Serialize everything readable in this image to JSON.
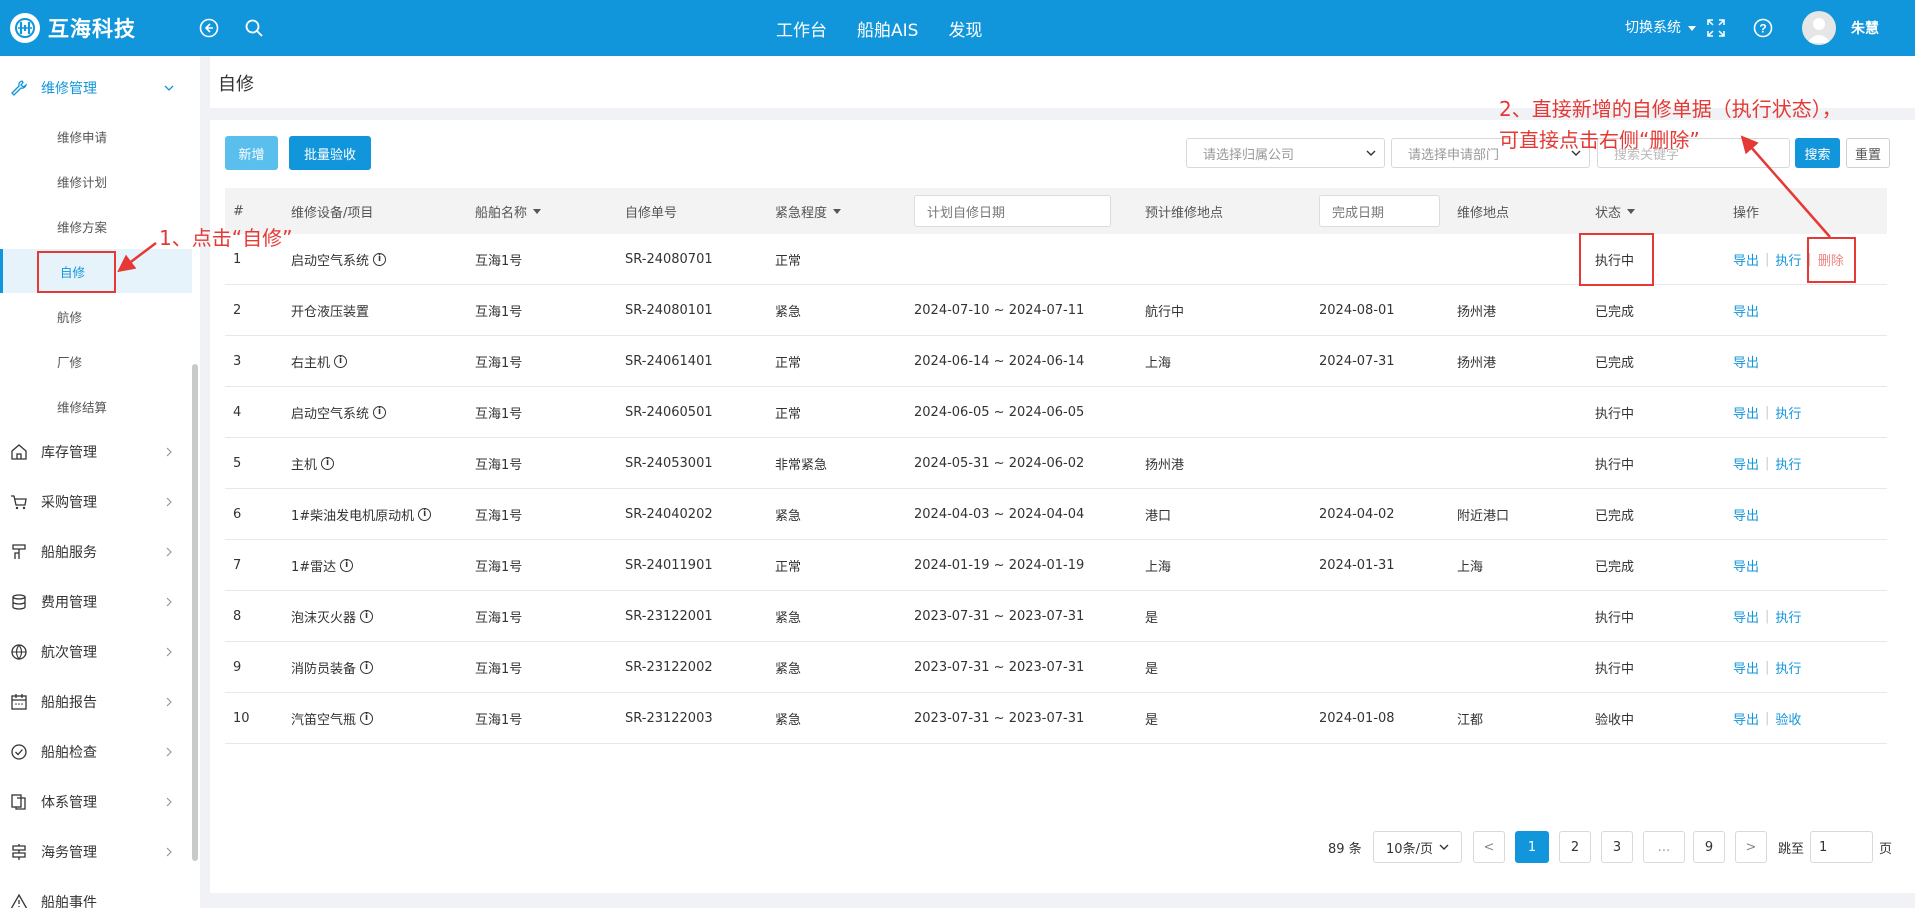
{
  "header": {
    "brand": "互海科技",
    "nav": [
      "工作台",
      "船舶AIS",
      "发现"
    ],
    "switch_system": "切换系统",
    "user_name": "朱慧"
  },
  "sidebar": {
    "groups": [
      {
        "label": "维修管理",
        "icon": "wrench-icon",
        "expanded": true,
        "items": [
          "维修申请",
          "维修计划",
          "维修方案",
          "自修",
          "航修",
          "厂修",
          "维修结算"
        ]
      },
      {
        "label": "库存管理",
        "icon": "warehouse-icon"
      },
      {
        "label": "采购管理",
        "icon": "cart-icon"
      },
      {
        "label": "船舶服务",
        "icon": "service-icon"
      },
      {
        "label": "费用管理",
        "icon": "coins-icon"
      },
      {
        "label": "航次管理",
        "icon": "globe-icon"
      },
      {
        "label": "船舶报告",
        "icon": "calendar-icon"
      },
      {
        "label": "船舶检查",
        "icon": "check-circle-icon"
      },
      {
        "label": "体系管理",
        "icon": "documents-icon"
      },
      {
        "label": "海务管理",
        "icon": "signpost-icon"
      },
      {
        "label": "船舶事件",
        "icon": "warning-icon"
      }
    ],
    "active_item": "自修"
  },
  "page": {
    "title": "自修"
  },
  "toolbar": {
    "add_label": "新增",
    "batch_accept_label": "批量验收",
    "company_placeholder": "请选择归属公司",
    "dept_placeholder": "请选择申请部门",
    "keyword_placeholder": "搜索关键字",
    "search_label": "搜索",
    "reset_label": "重置"
  },
  "table": {
    "columns": [
      "#",
      "维修设备/项目",
      "船舶名称",
      "自修单号",
      "紧急程度",
      "计划自修日期",
      "预计维修地点",
      "完成日期",
      "维修地点",
      "状态",
      "操作"
    ],
    "rows": [
      {
        "no": "1",
        "item": "启动空气系统",
        "info": true,
        "ship": "互海1号",
        "order": "SR-24080701",
        "urgency": "正常",
        "plan": "",
        "est_place": "",
        "done": "",
        "place": "",
        "status": "执行中",
        "ops": [
          "导出",
          "执行",
          "删除"
        ]
      },
      {
        "no": "2",
        "item": "开仓液压装置",
        "info": false,
        "ship": "互海1号",
        "order": "SR-24080101",
        "urgency": "紧急",
        "plan": "2024-07-10 ~ 2024-07-11",
        "est_place": "航行中",
        "done": "2024-08-01",
        "place": "扬州港",
        "status": "已完成",
        "ops": [
          "导出"
        ]
      },
      {
        "no": "3",
        "item": "右主机",
        "info": true,
        "ship": "互海1号",
        "order": "SR-24061401",
        "urgency": "正常",
        "plan": "2024-06-14 ~ 2024-06-14",
        "est_place": "上海",
        "done": "2024-07-31",
        "place": "扬州港",
        "status": "已完成",
        "ops": [
          "导出"
        ]
      },
      {
        "no": "4",
        "item": "启动空气系统",
        "info": true,
        "ship": "互海1号",
        "order": "SR-24060501",
        "urgency": "正常",
        "plan": "2024-06-05 ~ 2024-06-05",
        "est_place": "",
        "done": "",
        "place": "",
        "status": "执行中",
        "ops": [
          "导出",
          "执行"
        ]
      },
      {
        "no": "5",
        "item": "主机",
        "info": true,
        "ship": "互海1号",
        "order": "SR-24053001",
        "urgency": "非常紧急",
        "plan": "2024-05-31 ~ 2024-06-02",
        "est_place": "扬州港",
        "done": "",
        "place": "",
        "status": "执行中",
        "ops": [
          "导出",
          "执行"
        ]
      },
      {
        "no": "6",
        "item": "1#柴油发电机原动机",
        "info": true,
        "ship": "互海1号",
        "order": "SR-24040202",
        "urgency": "紧急",
        "plan": "2024-04-03 ~ 2024-04-04",
        "est_place": "港口",
        "done": "2024-04-02",
        "place": "附近港口",
        "status": "已完成",
        "ops": [
          "导出"
        ]
      },
      {
        "no": "7",
        "item": "1#雷达",
        "info": true,
        "ship": "互海1号",
        "order": "SR-24011901",
        "urgency": "正常",
        "plan": "2024-01-19 ~ 2024-01-19",
        "est_place": "上海",
        "done": "2024-01-31",
        "place": "上海",
        "status": "已完成",
        "ops": [
          "导出"
        ]
      },
      {
        "no": "8",
        "item": "泡沫灭火器",
        "info": true,
        "ship": "互海1号",
        "order": "SR-23122001",
        "urgency": "紧急",
        "plan": "2023-07-31 ~ 2023-07-31",
        "est_place": "是",
        "done": "",
        "place": "",
        "status": "执行中",
        "ops": [
          "导出",
          "执行"
        ]
      },
      {
        "no": "9",
        "item": "消防员装备",
        "info": true,
        "ship": "互海1号",
        "order": "SR-23122002",
        "urgency": "紧急",
        "plan": "2023-07-31 ~ 2023-07-31",
        "est_place": "是",
        "done": "",
        "place": "",
        "status": "执行中",
        "ops": [
          "导出",
          "执行"
        ]
      },
      {
        "no": "10",
        "item": "汽笛空气瓶",
        "info": true,
        "ship": "互海1号",
        "order": "SR-23122003",
        "urgency": "紧急",
        "plan": "2023-07-31 ~ 2023-07-31",
        "est_place": "是",
        "done": "2024-01-08",
        "place": "江都",
        "status": "验收中",
        "ops": [
          "导出",
          "验收"
        ]
      }
    ]
  },
  "pagination": {
    "total": "89 条",
    "page_size": "10条/页",
    "pages": [
      "1",
      "2",
      "3",
      "...",
      "9"
    ],
    "current": "1",
    "prev": "<",
    "next": ">",
    "jump_label": "跳至",
    "jump_value": "1",
    "page_unit": "页"
  },
  "annotations": {
    "step1": "1、点击“自修”",
    "step2_line1": "2、直接新增的自修单据（执行状态），",
    "step2_line2": "可直接点击右侧“删除”",
    "color": "#e53935"
  }
}
